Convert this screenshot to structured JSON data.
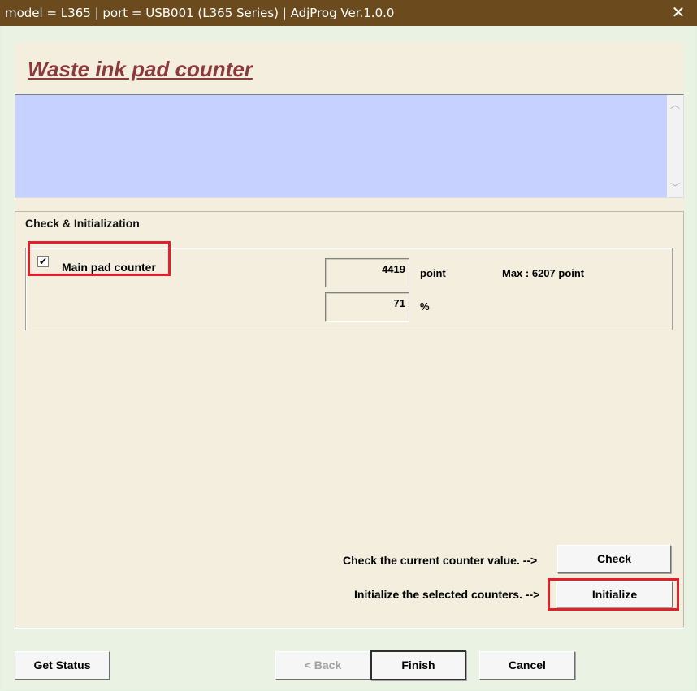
{
  "window": {
    "title": "model = L365 | port = USB001 (L365 Series) | AdjProg Ver.1.0.0",
    "close_glyph": "✕"
  },
  "header": {
    "title": "Waste ink pad counter"
  },
  "message_area": {
    "text": "",
    "scroll_up_glyph": "︿",
    "scroll_down_glyph": "﹀"
  },
  "group": {
    "title": "Check & Initialization",
    "counter": {
      "label": "Main pad counter",
      "checked": true,
      "check_glyph": "✔",
      "point_value": "4419",
      "point_unit": "point",
      "percent_value": "71",
      "percent_unit": "%",
      "max_text": "Max : 6207 point"
    }
  },
  "actions": {
    "check_caption": "Check the current counter value. -->",
    "check_label": "Check",
    "init_caption": "Initialize the selected counters. -->",
    "init_label": "Initialize"
  },
  "footer": {
    "get_status_label": "Get Status",
    "back_label": "< Back",
    "finish_label": "Finish",
    "cancel_label": "Cancel"
  },
  "colors": {
    "titlebar": "#6b4a1e",
    "title_text": "#8a3a3a",
    "message_bg": "#c6d1ff",
    "panel_bg": "#f3eedd",
    "highlight": "#e0202a"
  }
}
